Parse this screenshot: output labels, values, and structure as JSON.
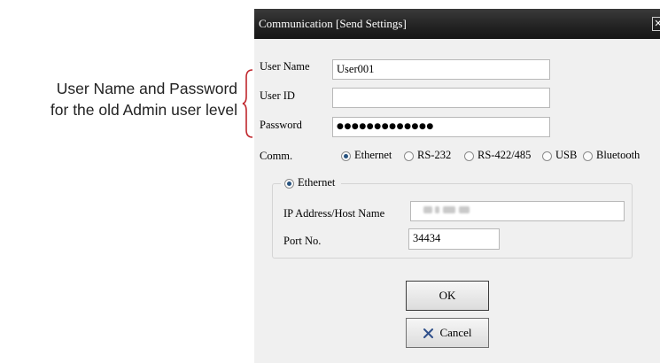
{
  "annotation": {
    "line1": "User Name and Password",
    "line2": "for the old Admin user level"
  },
  "dialog": {
    "title": "Communication [Send Settings]",
    "close_icon": "close-icon",
    "fields": {
      "user_name_label": "User Name",
      "user_name_value": "User001",
      "user_id_label": "User ID",
      "user_id_value": "",
      "password_label": "Password",
      "password_value": "●●●●●●●●●●●●●"
    },
    "comm": {
      "label": "Comm.",
      "options": [
        "Ethernet",
        "RS-232",
        "RS-422/485",
        "USB",
        "Bluetooth"
      ],
      "selected": "Ethernet"
    },
    "ethernet_group": {
      "legend": "Ethernet",
      "ip_label": "IP Address/Host Name",
      "port_label": "Port No.",
      "port_value": "34434"
    },
    "buttons": {
      "ok": "OK",
      "cancel": "Cancel"
    }
  },
  "colors": {
    "titlebar": "#222222",
    "dialog_bg": "#f0f0f0",
    "brace": "#c0272d",
    "cancel_icon": "#2f4f8a"
  }
}
